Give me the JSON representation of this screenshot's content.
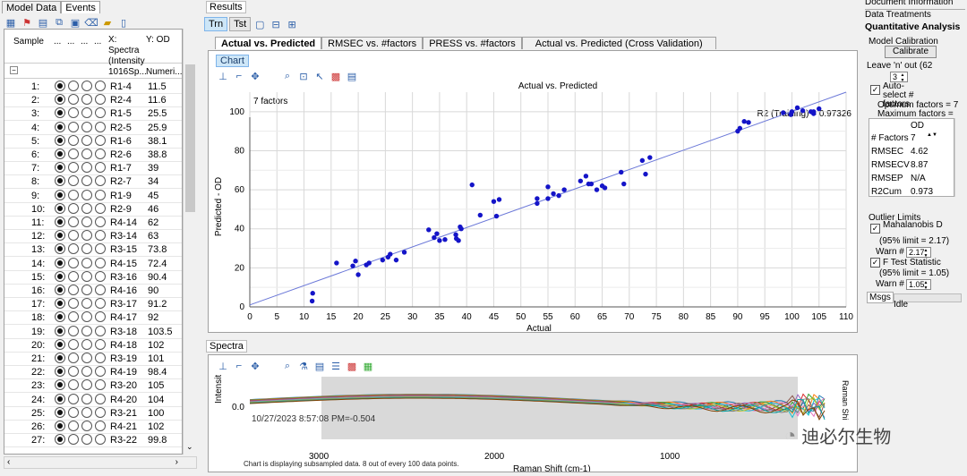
{
  "left": {
    "tabs": [
      "Model Data",
      "Events"
    ],
    "headers": {
      "sample": "Sample",
      "dots": [
        "...",
        "...",
        "...",
        "..."
      ],
      "x": "X: Spectra (Intensity",
      "y": "Y: OD"
    },
    "subheader": {
      "x": "1016Sp...",
      "y": "Numeri..."
    },
    "rows": [
      {
        "n": "1:",
        "x": "R1-4",
        "y": "11.5"
      },
      {
        "n": "2:",
        "x": "R2-4",
        "y": "11.6"
      },
      {
        "n": "3:",
        "x": "R1-5",
        "y": "25.5"
      },
      {
        "n": "4:",
        "x": "R2-5",
        "y": "25.9"
      },
      {
        "n": "5:",
        "x": "R1-6",
        "y": "38.1"
      },
      {
        "n": "6:",
        "x": "R2-6",
        "y": "38.8"
      },
      {
        "n": "7:",
        "x": "R1-7",
        "y": "39"
      },
      {
        "n": "8:",
        "x": "R2-7",
        "y": "34"
      },
      {
        "n": "9:",
        "x": "R1-9",
        "y": "45"
      },
      {
        "n": "10:",
        "x": "R2-9",
        "y": "46"
      },
      {
        "n": "11:",
        "x": "R4-14",
        "y": "62"
      },
      {
        "n": "12:",
        "x": "R3-14",
        "y": "63"
      },
      {
        "n": "13:",
        "x": "R3-15",
        "y": "73.8"
      },
      {
        "n": "14:",
        "x": "R4-15",
        "y": "72.4"
      },
      {
        "n": "15:",
        "x": "R3-16",
        "y": "90.4"
      },
      {
        "n": "16:",
        "x": "R4-16",
        "y": "90"
      },
      {
        "n": "17:",
        "x": "R3-17",
        "y": "91.2"
      },
      {
        "n": "18:",
        "x": "R4-17",
        "y": "92"
      },
      {
        "n": "19:",
        "x": "R3-18",
        "y": "103.5"
      },
      {
        "n": "20:",
        "x": "R4-18",
        "y": "102"
      },
      {
        "n": "21:",
        "x": "R3-19",
        "y": "101"
      },
      {
        "n": "22:",
        "x": "R4-19",
        "y": "98.4"
      },
      {
        "n": "23:",
        "x": "R3-20",
        "y": "105"
      },
      {
        "n": "24:",
        "x": "R4-20",
        "y": "104"
      },
      {
        "n": "25:",
        "x": "R3-21",
        "y": "100"
      },
      {
        "n": "26:",
        "x": "R4-21",
        "y": "102"
      },
      {
        "n": "27:",
        "x": "R3-22",
        "y": "99.8"
      }
    ]
  },
  "results": {
    "title": "Results",
    "mode_buttons": [
      "Trn",
      "Tst"
    ],
    "tabs": [
      "Actual vs. Predicted",
      "RMSEC vs. #factors",
      "PRESS vs. #factors",
      "Actual vs. Predicted (Cross Validation)"
    ],
    "chart_label": "Chart"
  },
  "spectra": {
    "title": "Spectra",
    "ylabel": "Intensity",
    "ytick": "0.0",
    "timestamp": "10/27/2023 8:57:08 PM=-0.504",
    "xticks": [
      "3000",
      "2000",
      "1000"
    ],
    "xlabel": "Raman Shift (cm-1)",
    "right_label": "Raman Shi",
    "footer": "Chart is displaying subsampled data. 8 out of every 100 data points."
  },
  "right": {
    "doc_info": "Document Information",
    "data_treatments": "Data Treatments",
    "quant": "Quantitative Analysis",
    "model_calibration": "Model Calibration",
    "calibrate": "Calibrate",
    "leave_out": "Leave 'n' out (62",
    "leave_value": "3",
    "auto_select": "Auto-select # factors",
    "optimum": "Optimum factors = 7",
    "maximum": "Maximum factors =",
    "stats_header": "OD",
    "stats": [
      {
        "k": "# Factors",
        "v": "7"
      },
      {
        "k": "RMSEC",
        "v": "4.62"
      },
      {
        "k": "RMSECV",
        "v": "8.87"
      },
      {
        "k": "RMSEP",
        "v": "N/A"
      },
      {
        "k": "R2Cum",
        "v": "0.973"
      }
    ],
    "outlier": "Outlier Limits",
    "mahal": "Mahalanobis D",
    "mahal_limit": "(95% limit = 2.17)",
    "warn_label": "Warn #",
    "mahal_warn": "2.17",
    "ftest": "F Test Statistic",
    "ftest_limit": "(95% limit = 1.05)",
    "ftest_warn": "1.05",
    "msgs": "Msgs",
    "idle": "Idle"
  },
  "watermark": "迪必尔生物",
  "chart_data": {
    "type": "scatter",
    "title": "Actual vs. Predicted",
    "factors_label": "7 factors",
    "r2_label": "R2 (Training) = 0.97326",
    "xlabel": "Actual",
    "ylabel": "Predicted - OD",
    "xlim": [
      0,
      110
    ],
    "ylim": [
      0,
      110
    ],
    "xticks": [
      0,
      5,
      10,
      15,
      20,
      25,
      30,
      35,
      40,
      45,
      50,
      55,
      60,
      65,
      70,
      75,
      80,
      85,
      90,
      95,
      100,
      105,
      110
    ],
    "yticks": [
      0,
      20,
      40,
      60,
      80,
      100
    ],
    "grid": true,
    "fit_line": [
      [
        0,
        1
      ],
      [
        110,
        110
      ]
    ],
    "points": [
      [
        11.5,
        3
      ],
      [
        11.6,
        7
      ],
      [
        16,
        22.5
      ],
      [
        19,
        21
      ],
      [
        19.5,
        23.5
      ],
      [
        20,
        16.5
      ],
      [
        21.5,
        21.5
      ],
      [
        22,
        22.5
      ],
      [
        24.5,
        24
      ],
      [
        25.5,
        25.5
      ],
      [
        25.9,
        27
      ],
      [
        27,
        24
      ],
      [
        28.5,
        28
      ],
      [
        33,
        39.5
      ],
      [
        34,
        35.5
      ],
      [
        34.5,
        37.5
      ],
      [
        35,
        34
      ],
      [
        36,
        34.5
      ],
      [
        38,
        37
      ],
      [
        38.1,
        35
      ],
      [
        38.5,
        34
      ],
      [
        38.8,
        41
      ],
      [
        39,
        40
      ],
      [
        41,
        62.5
      ],
      [
        42.5,
        47
      ],
      [
        45,
        54
      ],
      [
        45.5,
        46.5
      ],
      [
        46,
        55
      ],
      [
        53,
        55.5
      ],
      [
        53,
        53
      ],
      [
        55,
        55.5
      ],
      [
        55,
        61.5
      ],
      [
        56,
        58
      ],
      [
        57,
        57
      ],
      [
        58,
        60
      ],
      [
        61,
        64.5
      ],
      [
        62,
        67
      ],
      [
        62.5,
        63
      ],
      [
        63,
        63
      ],
      [
        64,
        60
      ],
      [
        65,
        62
      ],
      [
        65.5,
        61
      ],
      [
        68.5,
        69
      ],
      [
        69,
        63
      ],
      [
        72.4,
        75
      ],
      [
        73,
        68
      ],
      [
        73.8,
        76.5
      ],
      [
        90,
        90
      ],
      [
        90.4,
        91.5
      ],
      [
        91.2,
        95
      ],
      [
        92,
        94.5
      ],
      [
        98.4,
        99.5
      ],
      [
        99.8,
        98.5
      ],
      [
        100,
        100
      ],
      [
        101,
        102
      ],
      [
        102,
        100.5
      ],
      [
        103.5,
        100
      ],
      [
        104,
        100
      ],
      [
        104,
        99
      ],
      [
        105,
        101.5
      ]
    ]
  }
}
